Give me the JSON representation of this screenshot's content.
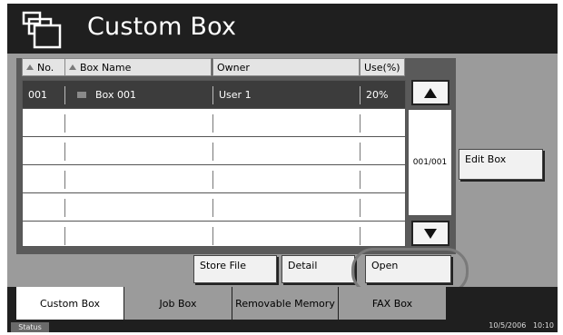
{
  "title": "Custom Box",
  "table": {
    "headers": {
      "no": "No.",
      "box_name": "Box Name",
      "owner": "Owner",
      "use": "Use(%)"
    },
    "rows": [
      {
        "no": "001",
        "box_name": "Box 001",
        "owner": "User 1",
        "use": "20%"
      }
    ],
    "page": "001/001"
  },
  "buttons": {
    "edit_box": "Edit Box",
    "store_file": "Store File",
    "detail": "Detail",
    "open": "Open"
  },
  "tabs": [
    "Custom Box",
    "Job Box",
    "Removable Memory",
    "FAX Box"
  ],
  "status": {
    "label": "Status",
    "date": "10/5/2006",
    "time": "10:10"
  }
}
